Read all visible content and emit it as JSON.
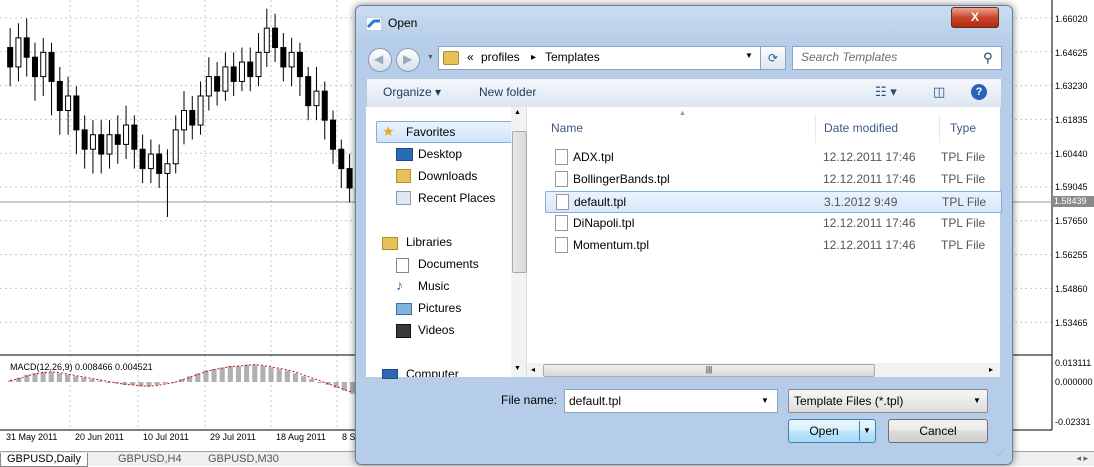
{
  "chart": {
    "price_levels": [
      "1.66020",
      "1.64625",
      "1.63230",
      "1.61835",
      "1.60440",
      "1.59045",
      "1.57650",
      "1.56255",
      "1.54860",
      "1.53465"
    ],
    "current_price": "1.58439",
    "macd_label": "MACD(12,26,9) 0.008466 0.004521",
    "macd_levels": [
      "0.013111",
      "0.000000",
      "-0.02331"
    ],
    "dates": [
      "31 May 2011",
      "20 Jun 2011",
      "10 Jul 2011",
      "29 Jul 2011",
      "18 Aug 2011",
      "8 S"
    ],
    "tabs": [
      "GBPUSD,Daily",
      "GBPUSD,H4",
      "GBPUSD,M30"
    ],
    "candles": [
      {
        "o": 1.648,
        "c": 1.64,
        "h": 1.656,
        "l": 1.632
      },
      {
        "o": 1.64,
        "c": 1.652,
        "h": 1.658,
        "l": 1.634
      },
      {
        "o": 1.652,
        "c": 1.644,
        "h": 1.66,
        "l": 1.636
      },
      {
        "o": 1.644,
        "c": 1.636,
        "h": 1.65,
        "l": 1.626
      },
      {
        "o": 1.636,
        "c": 1.646,
        "h": 1.652,
        "l": 1.628
      },
      {
        "o": 1.646,
        "c": 1.634,
        "h": 1.65,
        "l": 1.62
      },
      {
        "o": 1.634,
        "c": 1.622,
        "h": 1.64,
        "l": 1.612
      },
      {
        "o": 1.622,
        "c": 1.628,
        "h": 1.636,
        "l": 1.612
      },
      {
        "o": 1.628,
        "c": 1.614,
        "h": 1.632,
        "l": 1.604
      },
      {
        "o": 1.614,
        "c": 1.606,
        "h": 1.62,
        "l": 1.598
      },
      {
        "o": 1.606,
        "c": 1.612,
        "h": 1.618,
        "l": 1.596
      },
      {
        "o": 1.612,
        "c": 1.604,
        "h": 1.618,
        "l": 1.596
      },
      {
        "o": 1.604,
        "c": 1.612,
        "h": 1.618,
        "l": 1.598
      },
      {
        "o": 1.612,
        "c": 1.608,
        "h": 1.62,
        "l": 1.6
      },
      {
        "o": 1.608,
        "c": 1.616,
        "h": 1.624,
        "l": 1.602
      },
      {
        "o": 1.616,
        "c": 1.606,
        "h": 1.62,
        "l": 1.598
      },
      {
        "o": 1.606,
        "c": 1.598,
        "h": 1.612,
        "l": 1.592
      },
      {
        "o": 1.598,
        "c": 1.604,
        "h": 1.61,
        "l": 1.592
      },
      {
        "o": 1.604,
        "c": 1.596,
        "h": 1.608,
        "l": 1.59
      },
      {
        "o": 1.596,
        "c": 1.6,
        "h": 1.606,
        "l": 1.578
      },
      {
        "o": 1.6,
        "c": 1.614,
        "h": 1.62,
        "l": 1.596
      },
      {
        "o": 1.614,
        "c": 1.622,
        "h": 1.63,
        "l": 1.608
      },
      {
        "o": 1.622,
        "c": 1.616,
        "h": 1.628,
        "l": 1.61
      },
      {
        "o": 1.616,
        "c": 1.628,
        "h": 1.634,
        "l": 1.612
      },
      {
        "o": 1.628,
        "c": 1.636,
        "h": 1.644,
        "l": 1.622
      },
      {
        "o": 1.636,
        "c": 1.63,
        "h": 1.642,
        "l": 1.624
      },
      {
        "o": 1.63,
        "c": 1.64,
        "h": 1.646,
        "l": 1.626
      },
      {
        "o": 1.64,
        "c": 1.634,
        "h": 1.646,
        "l": 1.628
      },
      {
        "o": 1.634,
        "c": 1.642,
        "h": 1.648,
        "l": 1.63
      },
      {
        "o": 1.642,
        "c": 1.636,
        "h": 1.648,
        "l": 1.63
      },
      {
        "o": 1.636,
        "c": 1.646,
        "h": 1.654,
        "l": 1.632
      },
      {
        "o": 1.646,
        "c": 1.656,
        "h": 1.664,
        "l": 1.64
      },
      {
        "o": 1.656,
        "c": 1.648,
        "h": 1.662,
        "l": 1.642
      },
      {
        "o": 1.648,
        "c": 1.64,
        "h": 1.654,
        "l": 1.634
      },
      {
        "o": 1.64,
        "c": 1.646,
        "h": 1.652,
        "l": 1.632
      },
      {
        "o": 1.646,
        "c": 1.636,
        "h": 1.65,
        "l": 1.628
      },
      {
        "o": 1.636,
        "c": 1.624,
        "h": 1.64,
        "l": 1.618
      },
      {
        "o": 1.624,
        "c": 1.63,
        "h": 1.64,
        "l": 1.618
      },
      {
        "o": 1.63,
        "c": 1.618,
        "h": 1.634,
        "l": 1.61
      },
      {
        "o": 1.618,
        "c": 1.606,
        "h": 1.622,
        "l": 1.6
      },
      {
        "o": 1.606,
        "c": 1.598,
        "h": 1.61,
        "l": 1.59
      },
      {
        "o": 1.598,
        "c": 1.59,
        "h": 1.604,
        "l": 1.584
      },
      {
        "o": 1.59,
        "c": 1.584,
        "h": 1.594,
        "l": 1.578
      }
    ],
    "macd_hist": [
      0.001,
      0.003,
      0.005,
      0.006,
      0.007,
      0.007,
      0.006,
      0.005,
      0.004,
      0.003,
      0.002,
      0.001,
      0.0,
      -0.001,
      -0.002,
      -0.002,
      -0.003,
      -0.003,
      -0.002,
      -0.001,
      0.0,
      0.002,
      0.004,
      0.006,
      0.008,
      0.009,
      0.01,
      0.011,
      0.011,
      0.012,
      0.012,
      0.011,
      0.01,
      0.009,
      0.008,
      0.006,
      0.004,
      0.002,
      0.0,
      -0.002,
      -0.004,
      -0.006,
      -0.008
    ]
  },
  "dialog": {
    "title": "Open",
    "close_label": "X",
    "address": {
      "root": "«",
      "part1": "profiles",
      "sep": "▸",
      "part2": "Templates"
    },
    "search_placeholder": "Search Templates",
    "toolbar": {
      "organize": "Organize ▾",
      "new_folder": "New folder"
    },
    "nav": {
      "favorites": "Favorites",
      "desktop": "Desktop",
      "downloads": "Downloads",
      "recent": "Recent Places",
      "libraries": "Libraries",
      "documents": "Documents",
      "music": "Music",
      "pictures": "Pictures",
      "videos": "Videos",
      "computer": "Computer"
    },
    "columns": {
      "name": "Name",
      "date": "Date modified",
      "type": "Type"
    },
    "files": [
      {
        "name": "ADX.tpl",
        "date": "12.12.2011 17:46",
        "type": "TPL File"
      },
      {
        "name": "BollingerBands.tpl",
        "date": "12.12.2011 17:46",
        "type": "TPL File"
      },
      {
        "name": "default.tpl",
        "date": "3.1.2012 9:49",
        "type": "TPL File"
      },
      {
        "name": "DiNapoli.tpl",
        "date": "12.12.2011 17:46",
        "type": "TPL File"
      },
      {
        "name": "Momentum.tpl",
        "date": "12.12.2011 17:46",
        "type": "TPL File"
      }
    ],
    "file_name_label": "File name:",
    "file_name_value": "default.tpl",
    "file_type_value": "Template Files (*.tpl)",
    "open_label": "Open",
    "cancel_label": "Cancel"
  }
}
